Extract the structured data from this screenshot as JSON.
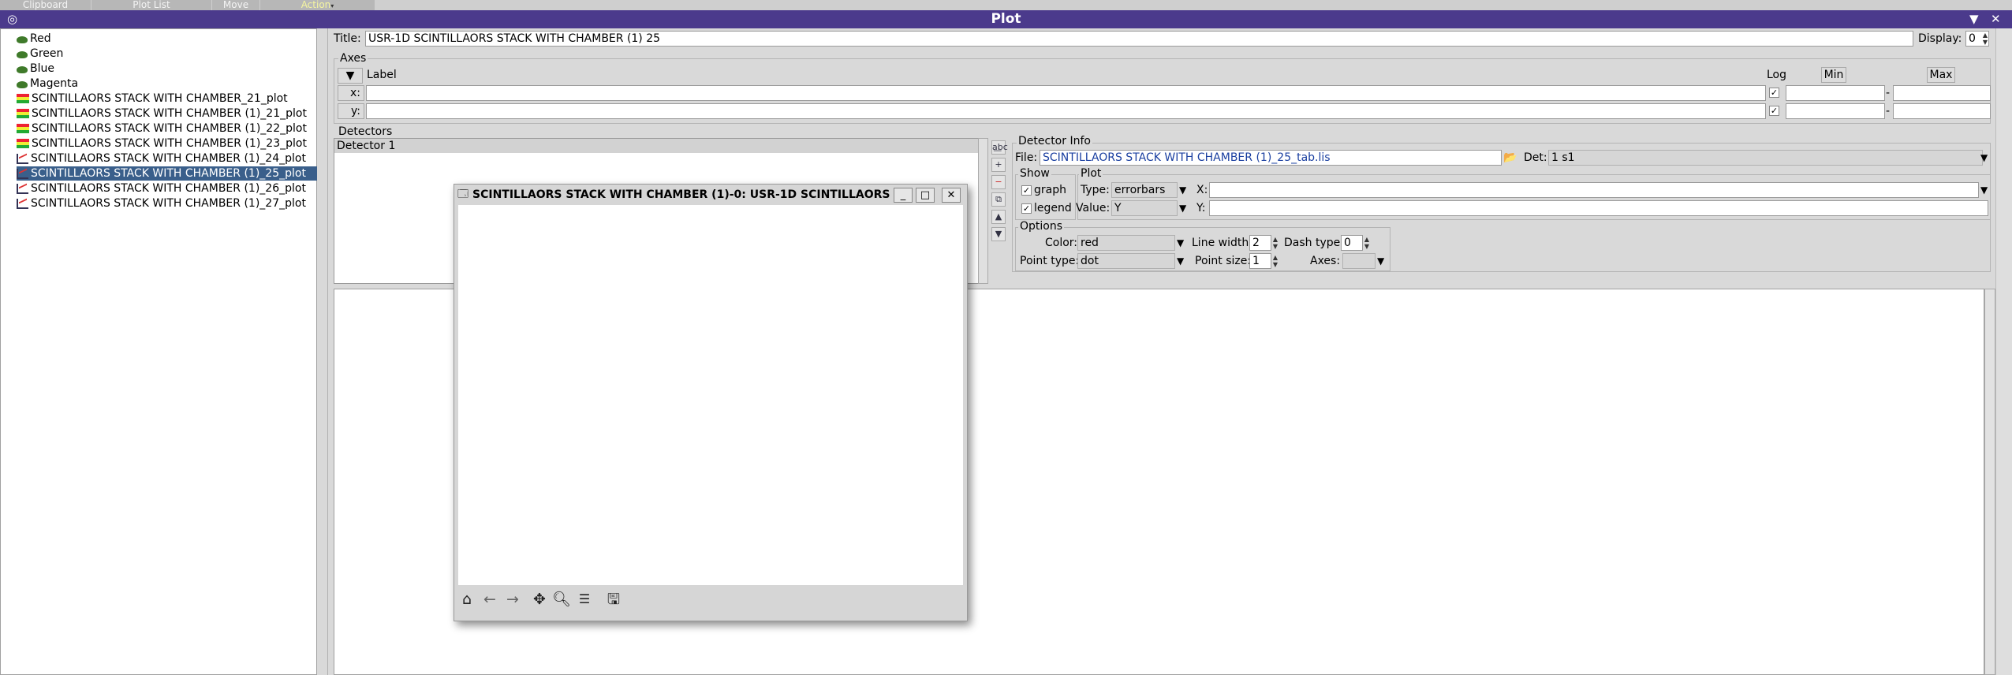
{
  "top_tabs": [
    {
      "label": "Clipboard"
    },
    {
      "label": "Plot List"
    },
    {
      "label": "Move"
    },
    {
      "label": "Action"
    }
  ],
  "window": {
    "title": "Plot",
    "menu_icon": "target-icon"
  },
  "tree": {
    "items": [
      {
        "label": "Red",
        "icon": "turtle-icon"
      },
      {
        "label": "Green",
        "icon": "turtle-icon"
      },
      {
        "label": "Blue",
        "icon": "turtle-icon"
      },
      {
        "label": "Magenta",
        "icon": "turtle-icon"
      },
      {
        "label": "SCINTILLAORS STACK WITH CHAMBER_21_plot",
        "icon": "colorbar-icon"
      },
      {
        "label": "SCINTILLAORS STACK WITH CHAMBER (1)_21_plot",
        "icon": "colorbar-icon"
      },
      {
        "label": "SCINTILLAORS STACK WITH CHAMBER (1)_22_plot",
        "icon": "colorbar-icon"
      },
      {
        "label": "SCINTILLAORS STACK WITH CHAMBER (1)_23_plot",
        "icon": "colorbar-icon"
      },
      {
        "label": "SCINTILLAORS STACK WITH CHAMBER (1)_24_plot",
        "icon": "lineplot-icon"
      },
      {
        "label": "SCINTILLAORS STACK WITH CHAMBER (1)_25_plot",
        "icon": "lineplot-icon",
        "selected": true
      },
      {
        "label": "SCINTILLAORS STACK WITH CHAMBER (1)_26_plot",
        "icon": "lineplot-icon"
      },
      {
        "label": "SCINTILLAORS STACK WITH CHAMBER (1)_27_plot",
        "icon": "lineplot-icon"
      }
    ]
  },
  "title_row": {
    "label": "Title:",
    "value": "USR-1D SCINTILLAORS STACK WITH CHAMBER (1) 25",
    "display_label": "Display:",
    "display_value": "0"
  },
  "axes": {
    "group_label": "Axes",
    "header_label": "Label",
    "log_label": "Log",
    "min_label": "Min",
    "max_label": "Max",
    "x_label": "x:",
    "y_label": "y:",
    "x_value": "",
    "y_value": "",
    "x_min": "",
    "x_max": "",
    "y_min": "",
    "y_max": "",
    "dash": "-"
  },
  "detectors": {
    "group_label": "Detectors",
    "items": [
      "Detector 1"
    ]
  },
  "detector_info": {
    "group_label": "Detector Info",
    "file_label": "File:",
    "file_value": "SCINTILLAORS STACK WITH CHAMBER (1)_25_tab.lis",
    "det_label": "Det:",
    "det_value": "1 s1"
  },
  "show": {
    "group_label": "Show",
    "graph_label": "graph",
    "legend_label": "legend",
    "graph_checked": true,
    "legend_checked": true
  },
  "plot_group": {
    "group_label": "Plot",
    "type_label": "Type:",
    "type_value": "errorbars",
    "value_label": "Value:",
    "value_value": "Y",
    "x_label": "X:",
    "y_label": "Y:",
    "x_value": "",
    "y_value": ""
  },
  "options": {
    "group_label": "Options",
    "color_label": "Color:",
    "color_value": "red",
    "linewidth_label": "Line width:",
    "linewidth_value": "2",
    "dashtype_label": "Dash type:",
    "dashtype_value": "0",
    "pointtype_label": "Point type:",
    "pointtype_value": "dot",
    "pointsize_label": "Point size:",
    "pointsize_value": "1",
    "axes_label": "Axes:",
    "axes_value": ""
  },
  "plot_window": {
    "title": "SCINTILLAORS STACK WITH CHAMBER (1)-0: USR-1D SCINTILLAORS ...",
    "toolbar": [
      "home-icon",
      "back-arrow-icon",
      "forward-arrow-icon",
      "pan-icon",
      "zoom-icon",
      "configure-icon",
      "save-icon"
    ]
  },
  "colors": {
    "titlebar": "#4b3a8c",
    "selection": "#3a5f8b",
    "action_tab_text": "#f5f5a0"
  }
}
